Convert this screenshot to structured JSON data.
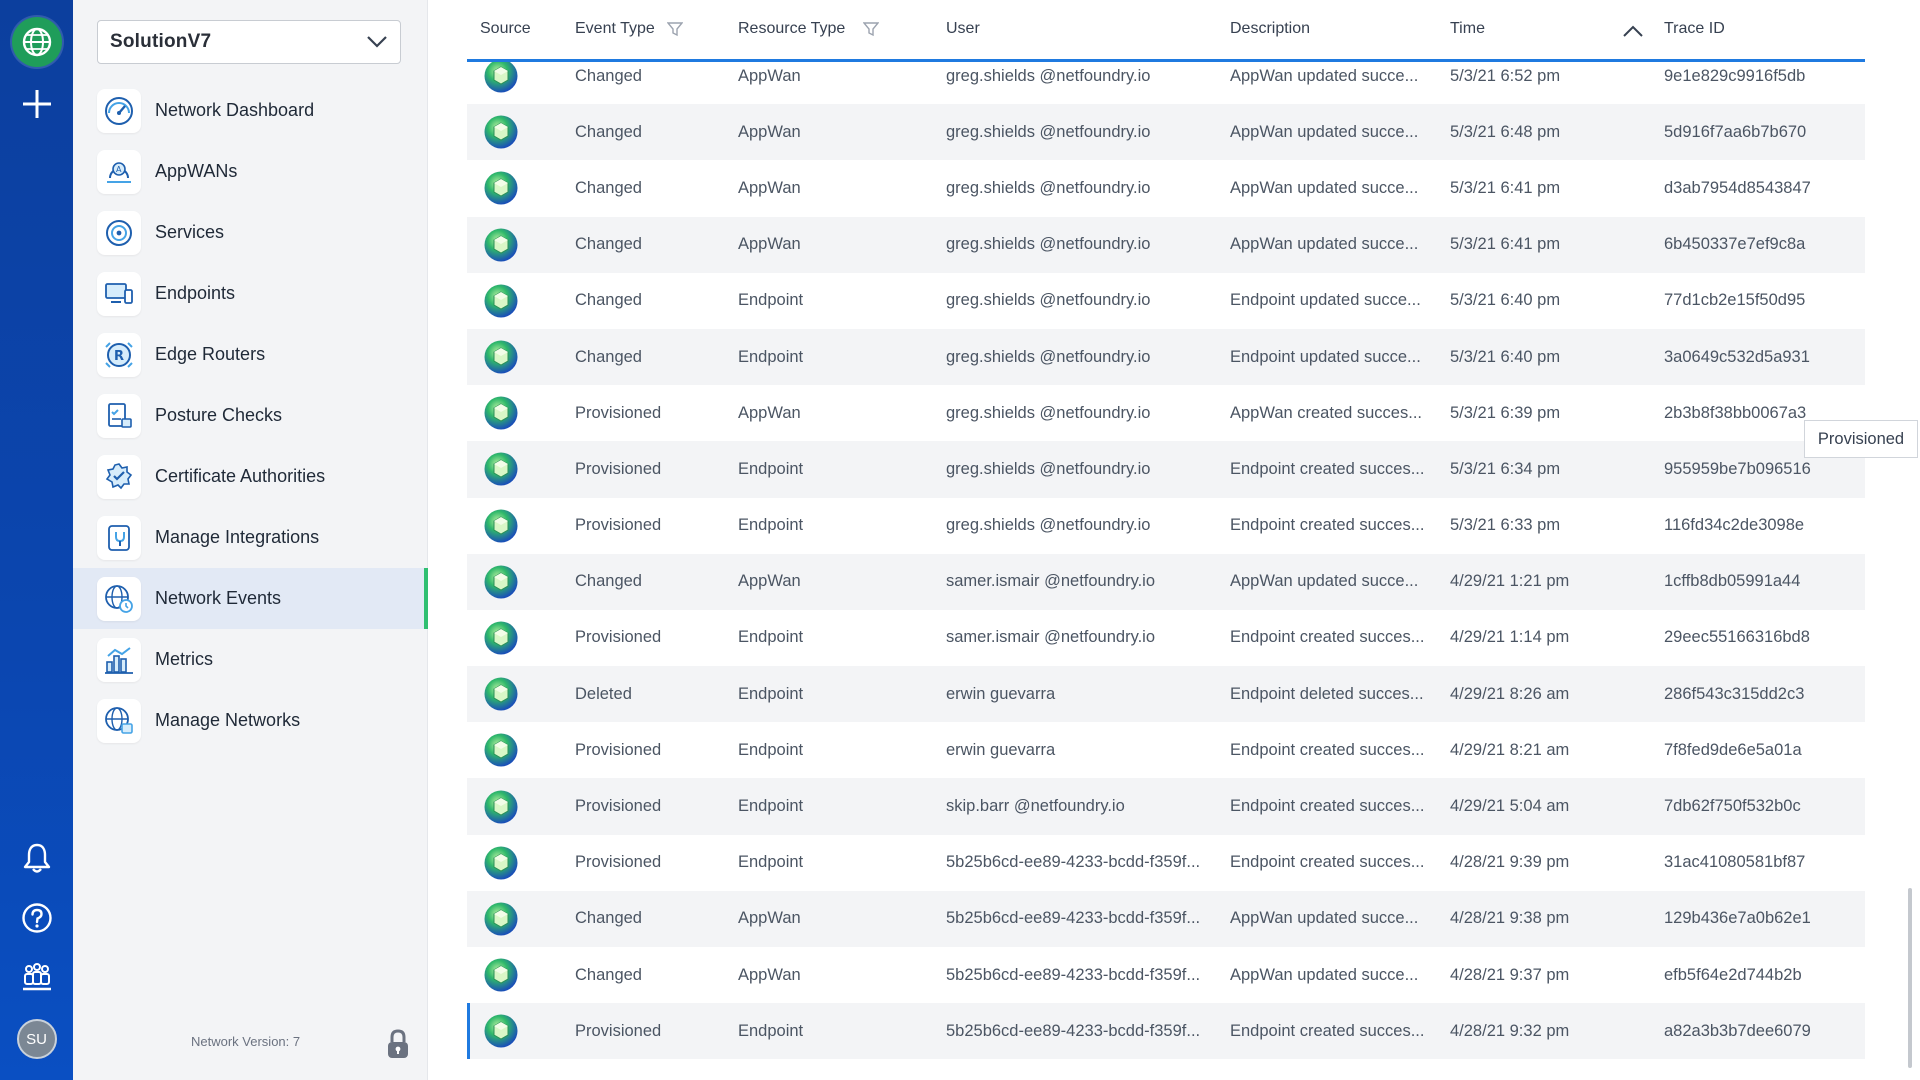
{
  "sidebar": {
    "network_selector": "SolutionV7",
    "items": [
      {
        "label": "Network Dashboard",
        "icon": "dashboard-gauge-icon"
      },
      {
        "label": "AppWANs",
        "icon": "appwan-icon"
      },
      {
        "label": "Services",
        "icon": "services-icon"
      },
      {
        "label": "Endpoints",
        "icon": "endpoints-icon"
      },
      {
        "label": "Edge Routers",
        "icon": "edge-router-icon"
      },
      {
        "label": "Posture Checks",
        "icon": "posture-check-icon"
      },
      {
        "label": "Certificate Authorities",
        "icon": "certificate-icon"
      },
      {
        "label": "Manage Integrations",
        "icon": "integrations-icon"
      },
      {
        "label": "Network Events",
        "icon": "network-events-icon"
      },
      {
        "label": "Metrics",
        "icon": "metrics-icon"
      },
      {
        "label": "Manage Networks",
        "icon": "manage-networks-icon"
      }
    ],
    "active_item": "Network Events",
    "network_version": "Network Version: 7"
  },
  "rail": {
    "avatar_initials": "SU"
  },
  "table": {
    "headers": {
      "source": "Source",
      "event_type": "Event Type",
      "resource_type": "Resource Type",
      "user": "User",
      "description": "Description",
      "time": "Time",
      "trace_id": "Trace ID"
    },
    "rows": [
      {
        "event": "Changed",
        "resource": "AppWan",
        "user": "greg.shields @netfoundry.io",
        "desc": "AppWan updated succe...",
        "time": "5/3/21 6:52 pm",
        "trace": "9e1e829c9916f5db"
      },
      {
        "event": "Changed",
        "resource": "AppWan",
        "user": "greg.shields @netfoundry.io",
        "desc": "AppWan updated succe...",
        "time": "5/3/21 6:48 pm",
        "trace": "5d916f7aa6b7b670"
      },
      {
        "event": "Changed",
        "resource": "AppWan",
        "user": "greg.shields @netfoundry.io",
        "desc": "AppWan updated succe...",
        "time": "5/3/21 6:41 pm",
        "trace": "d3ab7954d8543847"
      },
      {
        "event": "Changed",
        "resource": "AppWan",
        "user": "greg.shields @netfoundry.io",
        "desc": "AppWan updated succe...",
        "time": "5/3/21 6:41 pm",
        "trace": "6b450337e7ef9c8a"
      },
      {
        "event": "Changed",
        "resource": "Endpoint",
        "user": "greg.shields @netfoundry.io",
        "desc": "Endpoint updated succe...",
        "time": "5/3/21 6:40 pm",
        "trace": "77d1cb2e15f50d95"
      },
      {
        "event": "Changed",
        "resource": "Endpoint",
        "user": "greg.shields @netfoundry.io",
        "desc": "Endpoint updated succe...",
        "time": "5/3/21 6:40 pm",
        "trace": "3a0649c532d5a931"
      },
      {
        "event": "Provisioned",
        "resource": "AppWan",
        "user": "greg.shields @netfoundry.io",
        "desc": "AppWan created succes...",
        "time": "5/3/21 6:39 pm",
        "trace": "2b3b8f38bb0067a3"
      },
      {
        "event": "Provisioned",
        "resource": "Endpoint",
        "user": "greg.shields @netfoundry.io",
        "desc": "Endpoint created succes...",
        "time": "5/3/21 6:34 pm",
        "trace": "955959be7b096516"
      },
      {
        "event": "Provisioned",
        "resource": "Endpoint",
        "user": "greg.shields @netfoundry.io",
        "desc": "Endpoint created succes...",
        "time": "5/3/21 6:33 pm",
        "trace": "116fd34c2de3098e"
      },
      {
        "event": "Changed",
        "resource": "AppWan",
        "user": "samer.ismair @netfoundry.io",
        "desc": "AppWan updated succe...",
        "time": "4/29/21 1:21 pm",
        "trace": "1cffb8db05991a44"
      },
      {
        "event": "Provisioned",
        "resource": "Endpoint",
        "user": "samer.ismair @netfoundry.io",
        "desc": "Endpoint created succes...",
        "time": "4/29/21 1:14 pm",
        "trace": "29eec55166316bd8"
      },
      {
        "event": "Deleted",
        "resource": "Endpoint",
        "user": "erwin guevarra",
        "desc": "Endpoint deleted succes...",
        "time": "4/29/21 8:26 am",
        "trace": "286f543c315dd2c3"
      },
      {
        "event": "Provisioned",
        "resource": "Endpoint",
        "user": "erwin guevarra",
        "desc": "Endpoint created succes...",
        "time": "4/29/21 8:21 am",
        "trace": "7f8fed9de6e5a01a"
      },
      {
        "event": "Provisioned",
        "resource": "Endpoint",
        "user": "skip.barr @netfoundry.io",
        "desc": "Endpoint created succes...",
        "time": "4/29/21 5:04 am",
        "trace": "7db62f750f532b0c"
      },
      {
        "event": "Provisioned",
        "resource": "Endpoint",
        "user": "5b25b6cd-ee89-4233-bcdd-f359f...",
        "desc": "Endpoint created succes...",
        "time": "4/28/21 9:39 pm",
        "trace": "31ac41080581bf87"
      },
      {
        "event": "Changed",
        "resource": "AppWan",
        "user": "5b25b6cd-ee89-4233-bcdd-f359f...",
        "desc": "AppWan updated succe...",
        "time": "4/28/21 9:38 pm",
        "trace": "129b436e7a0b62e1"
      },
      {
        "event": "Changed",
        "resource": "AppWan",
        "user": "5b25b6cd-ee89-4233-bcdd-f359f...",
        "desc": "AppWan updated succe...",
        "time": "4/28/21 9:37 pm",
        "trace": "efb5f64e2d744b2b"
      },
      {
        "event": "Provisioned",
        "resource": "Endpoint",
        "user": "5b25b6cd-ee89-4233-bcdd-f359f...",
        "desc": "Endpoint created succes...",
        "time": "4/28/21 9:32 pm",
        "trace": "a82a3b3b7dee6079"
      }
    ]
  },
  "tooltip": "Provisioned",
  "colors": {
    "rail": "#0b46b0",
    "accent": "#1f7ae0",
    "active_marker": "#2fbf71",
    "globe": "#1f9d5a"
  }
}
